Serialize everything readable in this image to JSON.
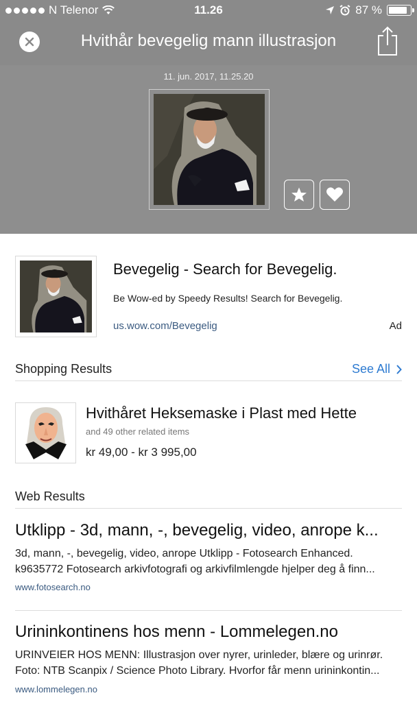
{
  "status_bar": {
    "carrier": "N Telenor",
    "time": "11.26",
    "battery": "87 %",
    "battery_level": 0.87
  },
  "header": {
    "title": "Hvithår bevegelig mann illustrasjon"
  },
  "image_viewer": {
    "timestamp": "11. jun. 2017, 11.25.20"
  },
  "ad": {
    "title": "Bevegelig - Search for Bevegelig.",
    "description": "Be Wow-ed by Speedy Results! Search for Bevegelig.",
    "url": "us.wow.com/Bevegelig",
    "label": "Ad"
  },
  "shopping": {
    "heading": "Shopping Results",
    "see_all": "See All",
    "product": {
      "title": "Hvithåret Heksemaske i Plast med Hette",
      "related": "and 49 other related items",
      "price": "kr 49,00 - kr 3 995,00"
    }
  },
  "web": {
    "heading": "Web Results",
    "results": [
      {
        "title": "Utklipp - 3d, mann, -, bevegelig, video, anrope k...",
        "line1": "3d, mann, -, bevegelig, video, anrope Utklipp - Fotosearch Enhanced.",
        "line2": "k9635772 Fotosearch arkivfotografi og arkivfilmlengde hjelper deg å finn...",
        "url": "www.fotosearch.no"
      },
      {
        "title": "Urininkontinens hos menn - Lommelegen.no",
        "line1": "URINVEIER HOS MENN: Illustrasjon over nyrer, urinleder, blære og urinrør.",
        "line2": "Foto: NTB Scanpix / Science Photo Library. Hvorfor får menn urininkontin...",
        "url": "www.lommelegen.no"
      }
    ]
  },
  "colors": {
    "header_bg": "#8a8a8a",
    "viewer_bg": "#8e8e8e",
    "link_blue": "#2e7bd1",
    "url_blue": "#3a5a80"
  }
}
